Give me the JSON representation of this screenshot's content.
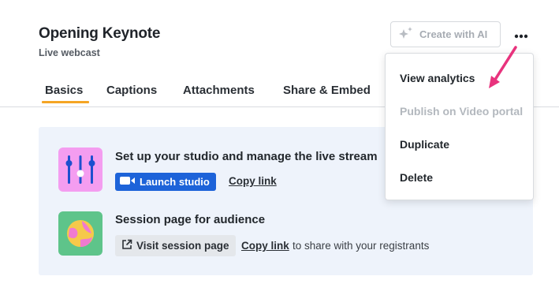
{
  "header": {
    "title": "Opening Keynote",
    "subtitle": "Live webcast",
    "ai_button_label": "Create with AI",
    "ai_button_icon": "sparkle-icon",
    "more_icon": "more-horizontal-icon"
  },
  "tabs": [
    {
      "label": "Basics",
      "active": true
    },
    {
      "label": "Captions",
      "active": false
    },
    {
      "label": "Attachments",
      "active": false
    },
    {
      "label": "Share & Embed",
      "active": false
    }
  ],
  "studio": {
    "title": "Set up your studio and manage the live stream",
    "icon": "mixer-sliders-icon",
    "launch_label": "Launch studio",
    "launch_icon": "video-camera-icon",
    "copy_link_label": "Copy link"
  },
  "audience": {
    "title": "Session page for audience",
    "icon": "globe-icon",
    "visit_label": "Visit session page",
    "visit_icon": "external-link-icon",
    "copy_link_label": "Copy link",
    "share_text": "to share with your registrants"
  },
  "menu": {
    "items": [
      {
        "label": "View analytics",
        "disabled": false
      },
      {
        "label": "Publish on Video portal",
        "disabled": true
      },
      {
        "label": "Duplicate",
        "disabled": false
      },
      {
        "label": "Delete",
        "disabled": false
      }
    ]
  },
  "colors": {
    "accent_tab": "#f5a524",
    "primary_button": "#1d63d9",
    "annotation_arrow": "#e8337d",
    "panel_bg": "#eef3fb"
  }
}
